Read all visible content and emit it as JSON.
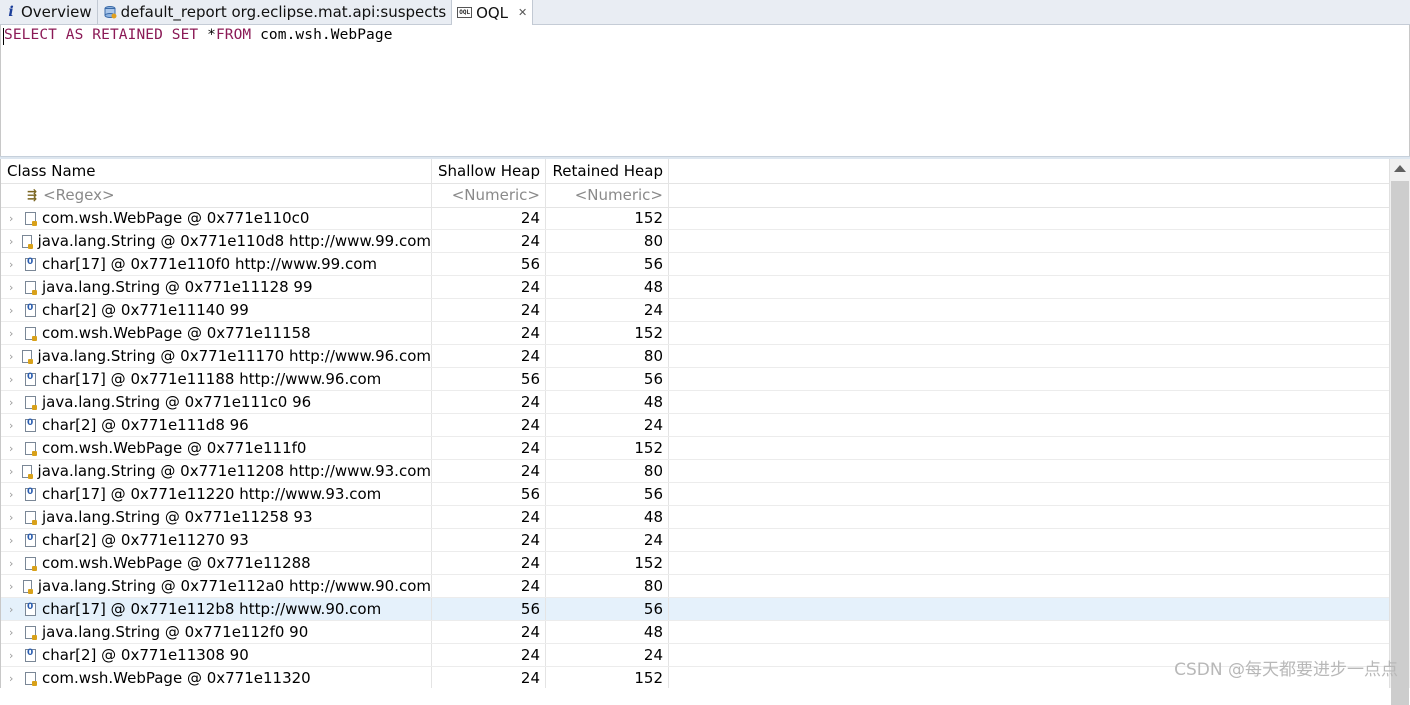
{
  "tabs": [
    {
      "label": "Overview",
      "icon": "info-icon",
      "active": false
    },
    {
      "label": "default_report  org.eclipse.mat.api:suspects",
      "icon": "report-icon",
      "active": false
    },
    {
      "label": "OQL",
      "icon": "oql-icon",
      "active": true,
      "closable": true
    }
  ],
  "query": {
    "tokens": [
      {
        "text": "SELECT AS RETAINED SET",
        "type": "keyword"
      },
      {
        "text": " *",
        "type": "plain"
      },
      {
        "text": "FROM",
        "type": "keyword"
      },
      {
        "text": " com.wsh.WebPage",
        "type": "plain"
      }
    ]
  },
  "table": {
    "columns": [
      "Class Name",
      "Shallow Heap",
      "Retained Heap"
    ],
    "filters": [
      "<Regex>",
      "<Numeric>",
      "<Numeric>"
    ],
    "rows": [
      {
        "name": "com.wsh.WebPage @ 0x771e110c0",
        "shallow": "24",
        "retained": "152",
        "kind": "obj"
      },
      {
        "name": "java.lang.String @ 0x771e110d8  http://www.99.com",
        "shallow": "24",
        "retained": "80",
        "kind": "obj"
      },
      {
        "name": "char[17] @ 0x771e110f0  http://www.99.com",
        "shallow": "56",
        "retained": "56",
        "kind": "arr"
      },
      {
        "name": "java.lang.String @ 0x771e11128  99",
        "shallow": "24",
        "retained": "48",
        "kind": "obj"
      },
      {
        "name": "char[2] @ 0x771e11140  99",
        "shallow": "24",
        "retained": "24",
        "kind": "arr"
      },
      {
        "name": "com.wsh.WebPage @ 0x771e11158",
        "shallow": "24",
        "retained": "152",
        "kind": "obj"
      },
      {
        "name": "java.lang.String @ 0x771e11170  http://www.96.com",
        "shallow": "24",
        "retained": "80",
        "kind": "obj"
      },
      {
        "name": "char[17] @ 0x771e11188  http://www.96.com",
        "shallow": "56",
        "retained": "56",
        "kind": "arr"
      },
      {
        "name": "java.lang.String @ 0x771e111c0  96",
        "shallow": "24",
        "retained": "48",
        "kind": "obj"
      },
      {
        "name": "char[2] @ 0x771e111d8  96",
        "shallow": "24",
        "retained": "24",
        "kind": "arr"
      },
      {
        "name": "com.wsh.WebPage @ 0x771e111f0",
        "shallow": "24",
        "retained": "152",
        "kind": "obj"
      },
      {
        "name": "java.lang.String @ 0x771e11208  http://www.93.com",
        "shallow": "24",
        "retained": "80",
        "kind": "obj"
      },
      {
        "name": "char[17] @ 0x771e11220  http://www.93.com",
        "shallow": "56",
        "retained": "56",
        "kind": "arr"
      },
      {
        "name": "java.lang.String @ 0x771e11258  93",
        "shallow": "24",
        "retained": "48",
        "kind": "obj"
      },
      {
        "name": "char[2] @ 0x771e11270  93",
        "shallow": "24",
        "retained": "24",
        "kind": "arr"
      },
      {
        "name": "com.wsh.WebPage @ 0x771e11288",
        "shallow": "24",
        "retained": "152",
        "kind": "obj"
      },
      {
        "name": "java.lang.String @ 0x771e112a0  http://www.90.com",
        "shallow": "24",
        "retained": "80",
        "kind": "obj"
      },
      {
        "name": "char[17] @ 0x771e112b8  http://www.90.com",
        "shallow": "56",
        "retained": "56",
        "kind": "arr",
        "selected": true
      },
      {
        "name": "java.lang.String @ 0x771e112f0  90",
        "shallow": "24",
        "retained": "48",
        "kind": "obj"
      },
      {
        "name": "char[2] @ 0x771e11308  90",
        "shallow": "24",
        "retained": "24",
        "kind": "arr"
      },
      {
        "name": "com.wsh.WebPage @ 0x771e11320",
        "shallow": "24",
        "retained": "152",
        "kind": "obj"
      }
    ]
  },
  "watermark": "CSDN @每天都要进步一点点",
  "colors": {
    "keyword": "#8b1a56",
    "selection": "#e5f1fb",
    "tabbar": "#e9edf3"
  }
}
